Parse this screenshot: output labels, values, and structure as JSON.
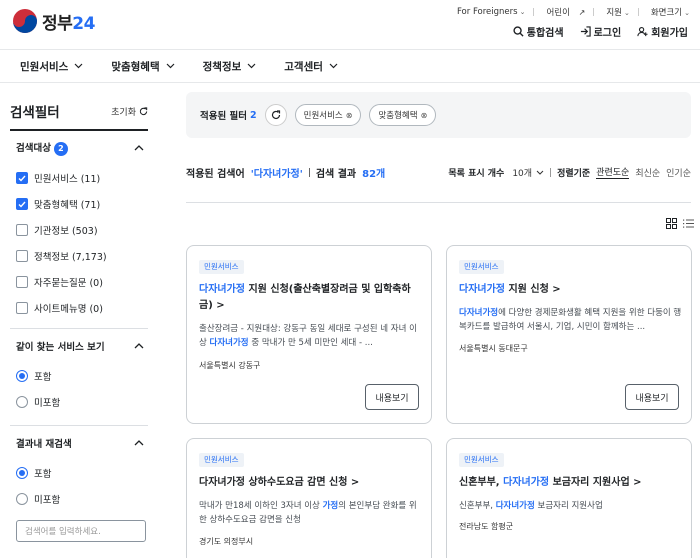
{
  "header": {
    "logo_text": "정부",
    "logo_num": "24",
    "util": {
      "foreigners": "For Foreigners",
      "easy": "어린이",
      "region": "지원",
      "zoom": "화면크기"
    },
    "actions": {
      "search": "통합검색",
      "login": "로그인",
      "signup": "회원가입"
    }
  },
  "nav": {
    "items": [
      {
        "label": "민원서비스"
      },
      {
        "label": "맞춤형혜택"
      },
      {
        "label": "정책정보"
      },
      {
        "label": "고객센터"
      }
    ]
  },
  "sidebar": {
    "title": "검색필터",
    "reset": "초기화",
    "target": {
      "title": "검색대상",
      "badge": "2",
      "options": [
        {
          "label": "민원서비스 (11)",
          "checked": true
        },
        {
          "label": "맞춤형혜택 (71)",
          "checked": true
        },
        {
          "label": "기관정보 (503)",
          "checked": false
        },
        {
          "label": "정책정보 (7,173)",
          "checked": false
        },
        {
          "label": "자주묻는질문 (0)",
          "checked": false
        },
        {
          "label": "사이트메뉴명 (0)",
          "checked": false
        }
      ]
    },
    "together": {
      "title": "같이 찾는 서비스 보기",
      "options": [
        {
          "label": "포함",
          "checked": true
        },
        {
          "label": "미포함",
          "checked": false
        }
      ]
    },
    "research": {
      "title": "결과내 재검색",
      "options": [
        {
          "label": "포함",
          "checked": true
        },
        {
          "label": "미포함",
          "checked": false
        }
      ],
      "placeholder": "검색어를 입력하세요."
    }
  },
  "filterbar": {
    "label": "적용된 필터",
    "count": "2",
    "chips": [
      "민원서비스",
      "맞춤형혜택"
    ]
  },
  "results": {
    "applied_label": "적용된 검색어",
    "keyword": "'다자녀가정'",
    "result_label": "검색 결과",
    "count": "82개",
    "per_page_label": "목록 표시 개수",
    "per_page": "10개",
    "sort_label": "정렬기준",
    "sorts": [
      "관련도순",
      "최신순",
      "인기순"
    ]
  },
  "cards": [
    {
      "tag": "민원서비스",
      "title_hl": "다자녀가정",
      "title_rest": " 지원 신청(출산축별장려금 및 입학축하금) >",
      "desc_pre": "출산장려금 - 지원대상: 강동구 동일 세대로 구성된 네 자녀 이상 ",
      "desc_hl": "다자녀가정",
      "desc_post": " 중 막내가 만 5세 미만인 세대 - ...",
      "region": "서울특별시 강동구",
      "button": "내용보기"
    },
    {
      "tag": "민원서비스",
      "title_hl": "다자녀가정",
      "title_rest": " 지원 신청 >",
      "desc_pre": "",
      "desc_hl": "다자녀가정",
      "desc_post": "에 다양한 경제문화생활 혜택 지원을 위한 다둥이 행복카드를 발급하여 서울시, 기업, 시민이 함께하는 ...",
      "region": "서울특별시 동대문구",
      "button": "내용보기"
    },
    {
      "tag": "민원서비스",
      "title_hl": "",
      "title_rest": "다자녀가정 상하수도요금 감면 신청 >",
      "desc_pre": "막내가 만18세 이하인 3자녀 이상 ",
      "desc_hl": "가정",
      "desc_post": "의 본인부담 완화를 위한 상하수도요금 감면을 신청",
      "region": "경기도 의정부시"
    },
    {
      "tag": "민원서비스",
      "title_pre": "신혼부부, ",
      "title_hl": "다자녀가정",
      "title_rest": " 보금자리 지원사업 >",
      "desc_pre": "신혼부부, ",
      "desc_hl": "다자녀가정",
      "desc_post": " 보금자리 지원사업",
      "region": "전라남도 함평군"
    }
  ]
}
